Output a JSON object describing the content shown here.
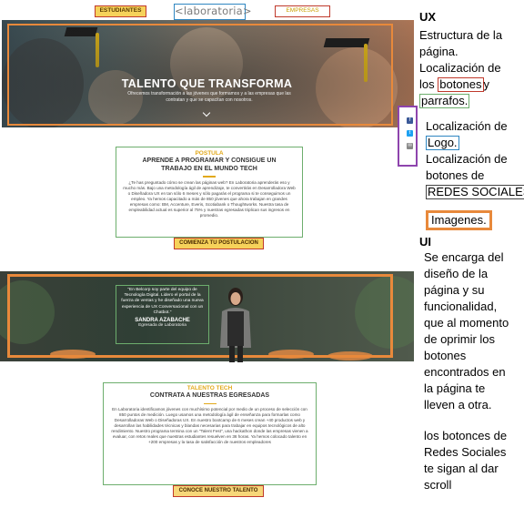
{
  "nav": {
    "estudiantes": "ESTUDIANTES",
    "logo": "<laboratoria>",
    "empresas": "EMPRESAS"
  },
  "hero": {
    "title": "TALENTO QUE TRANSFORMA",
    "subtitle": "Ofrecemos transformación a las jóvenes que formamos y a las empresas que las contratan y que se capacitan con nosotros."
  },
  "social": [
    {
      "icon": "facebook-icon",
      "glyph": "f",
      "color": "#3b5998"
    },
    {
      "icon": "twitter-icon",
      "glyph": "t",
      "color": "#1da1f2"
    },
    {
      "icon": "mail-icon",
      "glyph": "✉",
      "color": "#888888"
    }
  ],
  "section_postula": {
    "kicker": "POSTULA",
    "heading": "APRENDE A PROGRAMAR Y CONSIGUE UN TRABAJO EN EL MUNDO TECH",
    "body": "¿Te has preguntado cómo se crean las páginas web? En Laboratoria aprenderás eso y mucho más. Bajo una metodología ágil de aprendizaje, te convertirás en Desarrolladora Web o Diseñadora UX en tan sólo 6 meses y sólo pagarás el programa si te conseguimos un empleo. Ya hemos capacitado a más de 850 jóvenes que ahora trabajan en grandes empresas como: BM, Accenture, Everis, Scotiabank o Thoughtworks. Nuestra tasa de empleabilidad actual es superior al 75% y nuestras egresadas triplican sus ingresos en promedio.",
    "cta": "COMIENZA TU POSTULACION"
  },
  "testimonial": {
    "quote": "\"En Belcorp soy parte del equipo de Tecnología Digital. Lidero el portal de la fuerza de ventas y he diseñado una nueva experiencia de UX Conversacional con un Chatbot.\"",
    "name": "SANDRA AZABACHE",
    "role": "Egresada de Laboratoria"
  },
  "section_talento": {
    "kicker": "TALENTO TECH",
    "heading": "CONTRATA A NUESTRAS EGRESADAS",
    "body": "En Laboratoria identificamos jóvenes con muchísimo potencial por medio de un proceso de selección con 850 puntos de medición. Luego usamos una metodología ágil de enseñanza para formarlas como Desarrolladoras Web o Diseñadoras UX. En nuestro bootcamp de 6 meses crean +40 productos web y desarrollan las habilidades técnicas y blandas necesarias para trabajar en equipos tecnológicos de alto rendimiento. Nuestro programa termina con un \"Talent Fest\", una hackathon donde las empresas vienen a evaluar, con retos reales que nuestras estudiantes resuelven en 36 horas. Ya hemos colocado talento en +200 empresas y la tasa de satisfacción de nuestros empleadores",
    "cta": "CONOCE NUESTRO TALENTO"
  },
  "notes": {
    "ux_title": "UX",
    "ux_line1": "Estructura de la",
    "ux_line2": "página.",
    "ux_line3": "Localización de",
    "ux_line4a": "los",
    "ux_botones": "botones",
    "ux_line4b": "y",
    "ux_parrafos": "parrafos.",
    "logo_line1": "Localización de",
    "logo_word": "Logo.",
    "redes_line1": "Localización de",
    "redes_line2": "botones de",
    "redes_word": "REDES SOCIALES",
    "imagenes": "Imagenes.",
    "ui_title": "UI",
    "ui_lines": [
      "Se encarga del",
      "diseño de la",
      "página y su",
      "funcionalidad,",
      "que al momento",
      "de oprimir los",
      "botones",
      "encontrados en",
      "la página te",
      "lleven a otra."
    ],
    "final_lines": [
      "los botonces de",
      "Redes Sociales",
      "te sigan al dar",
      "scroll"
    ]
  },
  "colors": {
    "button_border": "#c0392b",
    "paragraph_border": "#6dae6d",
    "logo_border": "#2e86c1",
    "social_border": "#8e44ad",
    "image_border": "#e8893b",
    "accent_gold": "#e2a91a"
  }
}
